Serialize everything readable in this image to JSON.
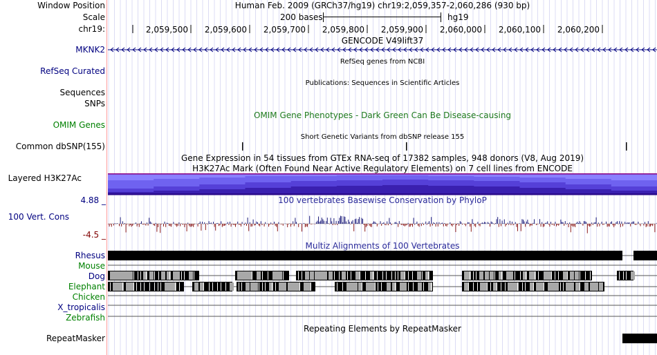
{
  "header": {
    "window_position_label": "Window Position",
    "window_position_text": "Human Feb. 2009 (GRCh37/hg19)   chr19:2,059,357-2,060,286 (930 bp)",
    "scale_label": "Scale",
    "scale_text": "200 bases",
    "scale_assembly": "hg19",
    "chrom_label": "chr19:",
    "ticks": [
      "2,059,500",
      "2,059,600",
      "2,059,700",
      "2,059,800",
      "2,059,900",
      "2,060,000",
      "2,060,100",
      "2,060,200"
    ]
  },
  "tracks": {
    "gencode": {
      "title": "GENCODE V49lift37",
      "gene_label": "MKNK2"
    },
    "refseq": {
      "label": "RefSeq Curated",
      "title": "RefSeq genes from NCBI"
    },
    "publications": {
      "label_line1": "Sequences",
      "label_line2": "SNPs",
      "title": "Publications: Sequences in Scientific Articles"
    },
    "omim": {
      "label": "OMIM Genes",
      "title": "OMIM Gene Phenotypes - Dark Green Can Be Disease-causing"
    },
    "dbsnp": {
      "label": "Common dbSNP(155)",
      "title": "Short Genetic Variants from dbSNP release 155"
    },
    "gtex": {
      "title": "Gene Expression in 54 tissues from GTEx RNA-seq of 17382 samples, 948 donors (V8, Aug 2019)"
    },
    "h3k27ac": {
      "label": "Layered H3K27Ac",
      "title": "H3K27Ac Mark (Often Found Near Active Regulatory Elements) on 7 cell lines from ENCODE"
    },
    "phylop": {
      "label": "100 Vert. Cons",
      "title": "100 vertebrates Basewise Conservation by PhyloP",
      "max_label": "4.88 _",
      "min_label": "-4.5 _"
    },
    "multiz": {
      "title": "Multiz Alignments of 100 Vertebrates",
      "species": [
        "Rhesus",
        "Mouse",
        "Dog",
        "Elephant",
        "Chicken",
        "X_tropicalis",
        "Zebrafish"
      ]
    },
    "repeatmasker": {
      "label": "RepeatMasker",
      "title": "Repeating Elements by RepeatMasker"
    }
  },
  "colors": {
    "label_link": "#000080",
    "omim_green": "#008000",
    "phylop_pos": "#1c1c7a",
    "phylop_neg": "#8b1a1a",
    "h3k27ac_top": "#7a6cff",
    "h3k27ac_mid": "#5a3fd6",
    "h3k27ac_dark": "#2a0a8a",
    "h3k27ac_border": "#8a0080",
    "alignment": "#000000"
  }
}
